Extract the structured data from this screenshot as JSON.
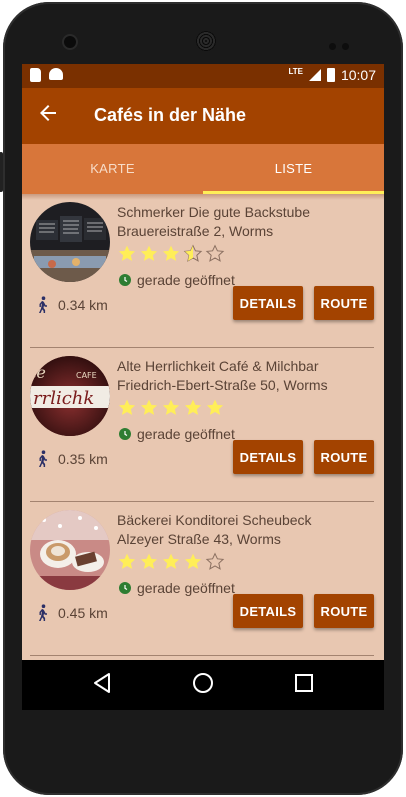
{
  "status_bar": {
    "time": "10:07",
    "network": "LTE"
  },
  "app_bar": {
    "back_icon": "arrow-back-icon",
    "title": "Cafés in der Nähe"
  },
  "tabs": [
    {
      "label": "KARTE",
      "active": false
    },
    {
      "label": "LISTE",
      "active": true
    }
  ],
  "colors": {
    "primary": "#a34300",
    "status_bar": "#7a3000",
    "tab_bar": "#d8763a",
    "tab_indicator": "#ffee58",
    "background": "#e8c7b1",
    "star": "#ffee58",
    "open_indicator": "#2e7d32"
  },
  "cafes": [
    {
      "name": "Schmerker Die gute Backstube",
      "address": "Brauereistraße 2, Worms",
      "rating": 3.5,
      "status": "gerade geöffnet",
      "distance": "0.34 km",
      "details_label": "DETAILS",
      "route_label": "ROUTE"
    },
    {
      "name": "Alte Herrlichkeit Café & Milchbar",
      "address": "Friedrich-Ebert-Straße 50, Worms",
      "rating": 5,
      "status": "gerade geöffnet",
      "distance": "0.35 km",
      "details_label": "DETAILS",
      "route_label": "ROUTE"
    },
    {
      "name": "Bäckerei Konditorei Scheubeck",
      "address": "Alzeyer Straße 43, Worms",
      "rating": 4,
      "status": "gerade geöffnet",
      "distance": "0.45 km",
      "details_label": "DETAILS",
      "route_label": "ROUTE"
    }
  ]
}
